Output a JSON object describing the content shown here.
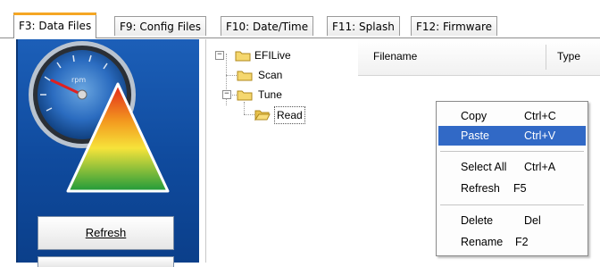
{
  "tabs": [
    {
      "label": "F3: Data Files",
      "active": true
    },
    {
      "label": "F9: Config Files",
      "active": false
    },
    {
      "label": "F10: Date/Time",
      "active": false
    },
    {
      "label": "F11: Splash",
      "active": false
    },
    {
      "label": "F12: Firmware",
      "active": false
    }
  ],
  "gauge": {
    "text": "rpm"
  },
  "side": {
    "refresh_label": "Refresh"
  },
  "tree": {
    "root": {
      "label": "EFILive",
      "expander": "−"
    },
    "scan": {
      "label": "Scan"
    },
    "tune": {
      "label": "Tune",
      "expander": "−"
    },
    "read": {
      "label": "Read"
    }
  },
  "list": {
    "columns": [
      "Filename",
      "Type"
    ]
  },
  "context_menu": {
    "items": [
      {
        "label": "Copy",
        "shortcut": "Ctrl+C"
      },
      {
        "label": "Paste",
        "shortcut": "Ctrl+V",
        "highlighted": true
      },
      {
        "label": "Select All",
        "shortcut": "Ctrl+A"
      },
      {
        "label": "Refresh",
        "shortcut": "F5"
      },
      {
        "label": "Delete",
        "shortcut": "Del"
      },
      {
        "label": "Rename",
        "shortcut": "F2"
      }
    ]
  },
  "colors": {
    "panel_blue": "#1c5fb8",
    "menu_highlight": "#3169c6",
    "tab_accent": "#f5a623",
    "folder_yellow": "#f5d76e"
  }
}
